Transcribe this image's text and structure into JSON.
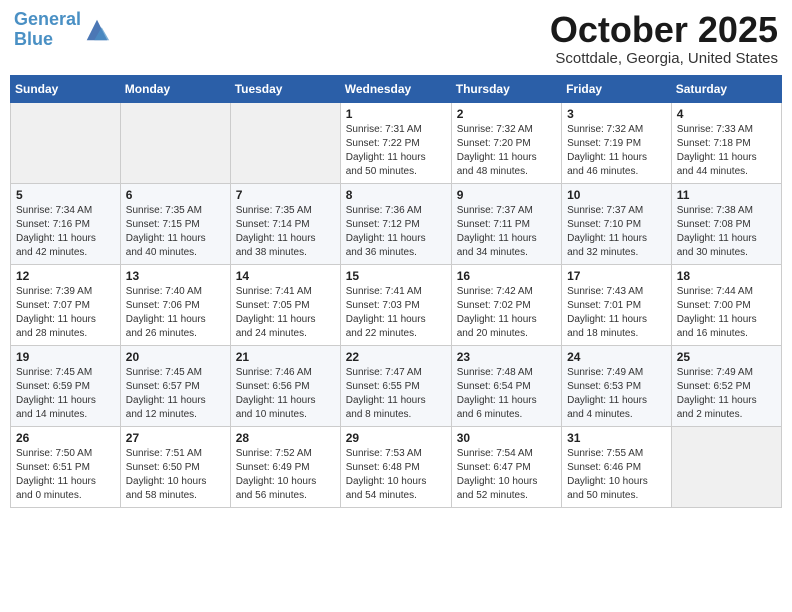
{
  "header": {
    "logo_line1": "General",
    "logo_line2": "Blue",
    "month": "October 2025",
    "location": "Scottdale, Georgia, United States"
  },
  "weekdays": [
    "Sunday",
    "Monday",
    "Tuesday",
    "Wednesday",
    "Thursday",
    "Friday",
    "Saturday"
  ],
  "weeks": [
    [
      {
        "day": "",
        "detail": ""
      },
      {
        "day": "",
        "detail": ""
      },
      {
        "day": "",
        "detail": ""
      },
      {
        "day": "1",
        "detail": "Sunrise: 7:31 AM\nSunset: 7:22 PM\nDaylight: 11 hours\nand 50 minutes."
      },
      {
        "day": "2",
        "detail": "Sunrise: 7:32 AM\nSunset: 7:20 PM\nDaylight: 11 hours\nand 48 minutes."
      },
      {
        "day": "3",
        "detail": "Sunrise: 7:32 AM\nSunset: 7:19 PM\nDaylight: 11 hours\nand 46 minutes."
      },
      {
        "day": "4",
        "detail": "Sunrise: 7:33 AM\nSunset: 7:18 PM\nDaylight: 11 hours\nand 44 minutes."
      }
    ],
    [
      {
        "day": "5",
        "detail": "Sunrise: 7:34 AM\nSunset: 7:16 PM\nDaylight: 11 hours\nand 42 minutes."
      },
      {
        "day": "6",
        "detail": "Sunrise: 7:35 AM\nSunset: 7:15 PM\nDaylight: 11 hours\nand 40 minutes."
      },
      {
        "day": "7",
        "detail": "Sunrise: 7:35 AM\nSunset: 7:14 PM\nDaylight: 11 hours\nand 38 minutes."
      },
      {
        "day": "8",
        "detail": "Sunrise: 7:36 AM\nSunset: 7:12 PM\nDaylight: 11 hours\nand 36 minutes."
      },
      {
        "day": "9",
        "detail": "Sunrise: 7:37 AM\nSunset: 7:11 PM\nDaylight: 11 hours\nand 34 minutes."
      },
      {
        "day": "10",
        "detail": "Sunrise: 7:37 AM\nSunset: 7:10 PM\nDaylight: 11 hours\nand 32 minutes."
      },
      {
        "day": "11",
        "detail": "Sunrise: 7:38 AM\nSunset: 7:08 PM\nDaylight: 11 hours\nand 30 minutes."
      }
    ],
    [
      {
        "day": "12",
        "detail": "Sunrise: 7:39 AM\nSunset: 7:07 PM\nDaylight: 11 hours\nand 28 minutes."
      },
      {
        "day": "13",
        "detail": "Sunrise: 7:40 AM\nSunset: 7:06 PM\nDaylight: 11 hours\nand 26 minutes."
      },
      {
        "day": "14",
        "detail": "Sunrise: 7:41 AM\nSunset: 7:05 PM\nDaylight: 11 hours\nand 24 minutes."
      },
      {
        "day": "15",
        "detail": "Sunrise: 7:41 AM\nSunset: 7:03 PM\nDaylight: 11 hours\nand 22 minutes."
      },
      {
        "day": "16",
        "detail": "Sunrise: 7:42 AM\nSunset: 7:02 PM\nDaylight: 11 hours\nand 20 minutes."
      },
      {
        "day": "17",
        "detail": "Sunrise: 7:43 AM\nSunset: 7:01 PM\nDaylight: 11 hours\nand 18 minutes."
      },
      {
        "day": "18",
        "detail": "Sunrise: 7:44 AM\nSunset: 7:00 PM\nDaylight: 11 hours\nand 16 minutes."
      }
    ],
    [
      {
        "day": "19",
        "detail": "Sunrise: 7:45 AM\nSunset: 6:59 PM\nDaylight: 11 hours\nand 14 minutes."
      },
      {
        "day": "20",
        "detail": "Sunrise: 7:45 AM\nSunset: 6:57 PM\nDaylight: 11 hours\nand 12 minutes."
      },
      {
        "day": "21",
        "detail": "Sunrise: 7:46 AM\nSunset: 6:56 PM\nDaylight: 11 hours\nand 10 minutes."
      },
      {
        "day": "22",
        "detail": "Sunrise: 7:47 AM\nSunset: 6:55 PM\nDaylight: 11 hours\nand 8 minutes."
      },
      {
        "day": "23",
        "detail": "Sunrise: 7:48 AM\nSunset: 6:54 PM\nDaylight: 11 hours\nand 6 minutes."
      },
      {
        "day": "24",
        "detail": "Sunrise: 7:49 AM\nSunset: 6:53 PM\nDaylight: 11 hours\nand 4 minutes."
      },
      {
        "day": "25",
        "detail": "Sunrise: 7:49 AM\nSunset: 6:52 PM\nDaylight: 11 hours\nand 2 minutes."
      }
    ],
    [
      {
        "day": "26",
        "detail": "Sunrise: 7:50 AM\nSunset: 6:51 PM\nDaylight: 11 hours\nand 0 minutes."
      },
      {
        "day": "27",
        "detail": "Sunrise: 7:51 AM\nSunset: 6:50 PM\nDaylight: 10 hours\nand 58 minutes."
      },
      {
        "day": "28",
        "detail": "Sunrise: 7:52 AM\nSunset: 6:49 PM\nDaylight: 10 hours\nand 56 minutes."
      },
      {
        "day": "29",
        "detail": "Sunrise: 7:53 AM\nSunset: 6:48 PM\nDaylight: 10 hours\nand 54 minutes."
      },
      {
        "day": "30",
        "detail": "Sunrise: 7:54 AM\nSunset: 6:47 PM\nDaylight: 10 hours\nand 52 minutes."
      },
      {
        "day": "31",
        "detail": "Sunrise: 7:55 AM\nSunset: 6:46 PM\nDaylight: 10 hours\nand 50 minutes."
      },
      {
        "day": "",
        "detail": ""
      }
    ]
  ]
}
